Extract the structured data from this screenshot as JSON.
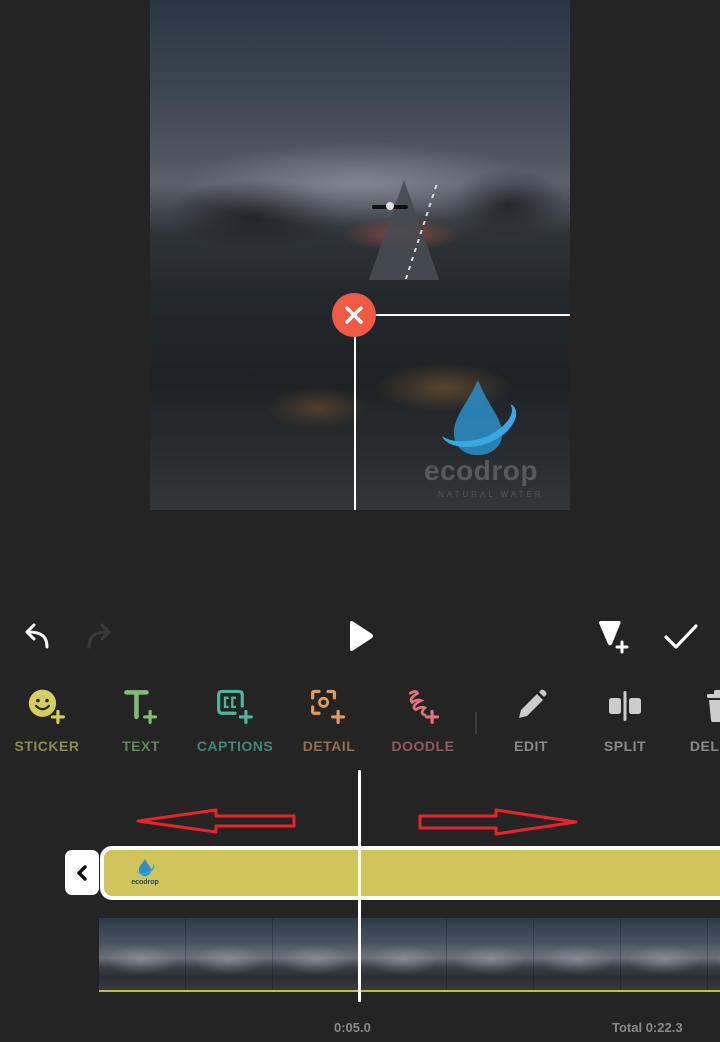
{
  "preview": {
    "watermark_text": "ecodrop",
    "watermark_subtext": "NATURAL WATER"
  },
  "playback": {
    "undo_icon": "undo-icon",
    "redo_icon": "redo-icon",
    "play_icon": "play-icon",
    "keyframe_icon": "add-keyframe-icon",
    "done_icon": "checkmark-icon"
  },
  "toolbar": {
    "items": [
      {
        "label": "STICKER",
        "icon": "sticker-add-icon",
        "color": "#d6ce5e",
        "label_color": "#8f8a4a"
      },
      {
        "label": "TEXT",
        "icon": "text-add-icon",
        "color": "#7fbf73",
        "label_color": "#5e8a58"
      },
      {
        "label": "CAPTIONS",
        "icon": "captions-add-icon",
        "color": "#4fb59c",
        "label_color": "#3f8a7c"
      },
      {
        "label": "DETAIL",
        "icon": "detail-add-icon",
        "color": "#e39a5f",
        "label_color": "#9a6e4c"
      },
      {
        "label": "DOODLE",
        "icon": "doodle-add-icon",
        "color": "#e2727c",
        "label_color": "#9a5660"
      },
      {
        "label": "EDIT",
        "icon": "pencil-icon",
        "color": "#cccccc",
        "label_color": "#8a8a8a"
      },
      {
        "label": "SPLIT",
        "icon": "split-icon",
        "color": "#cccccc",
        "label_color": "#8a8a8a"
      },
      {
        "label": "DELETE",
        "icon": "trash-icon",
        "color": "#cccccc",
        "label_color": "#8a8a8a"
      }
    ]
  },
  "timeline": {
    "sticker_track_label": "ecodrop",
    "current_time": "0:05.0",
    "total_time": "Total 0:22.3",
    "frame_count": 8,
    "track_color": "#d1c45a",
    "annotation_color": "#e8242a"
  }
}
